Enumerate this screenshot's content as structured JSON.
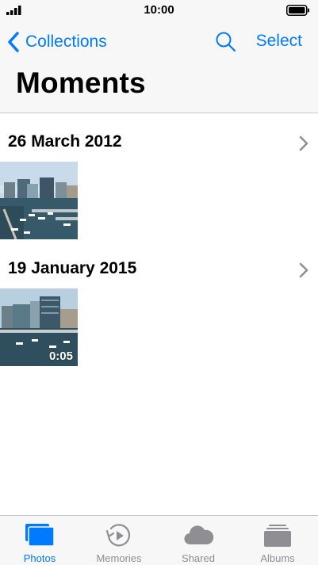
{
  "status_bar": {
    "time": "10:00"
  },
  "nav": {
    "back_label": "Collections",
    "select_label": "Select",
    "title": "Moments"
  },
  "moments": [
    {
      "date": "26 March 2012",
      "items": [
        {
          "type": "photo",
          "duration": ""
        }
      ]
    },
    {
      "date": "19 January 2015",
      "items": [
        {
          "type": "video",
          "duration": "0:05"
        }
      ]
    }
  ],
  "tabs": [
    {
      "label": "Photos",
      "icon": "photos-icon",
      "active": true
    },
    {
      "label": "Memories",
      "icon": "memories-icon",
      "active": false
    },
    {
      "label": "Shared",
      "icon": "cloud-icon",
      "active": false
    },
    {
      "label": "Albums",
      "icon": "albums-icon",
      "active": false
    }
  ],
  "colors": {
    "accent": "#007aff",
    "inactive": "#8e8e93",
    "bar_background": "#f7f7f7"
  }
}
